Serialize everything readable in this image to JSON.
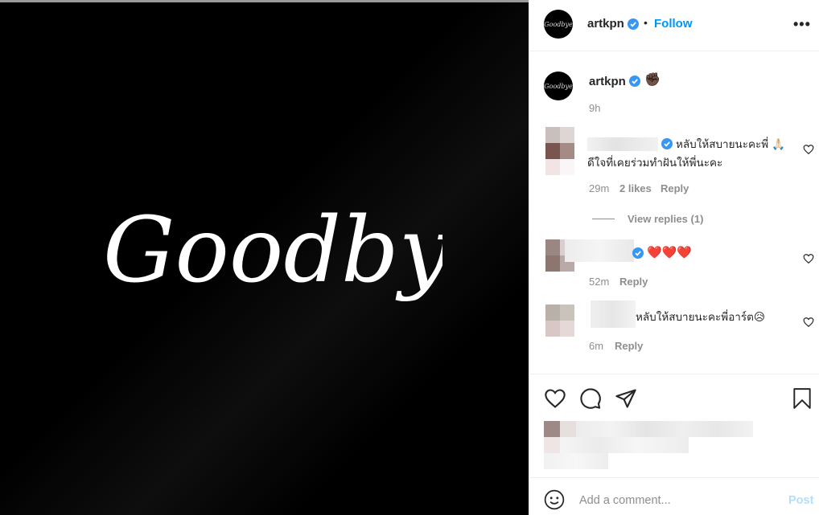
{
  "media": {
    "image_text": "Goodbye"
  },
  "post_header": {
    "username": "artkpn",
    "separator": "•",
    "follow_label": "Follow",
    "more_label": "•••"
  },
  "caption": {
    "username": "artkpn",
    "emoji": "✊🏿",
    "time": "9h"
  },
  "comments": [
    {
      "text": "หลับให้สบายนะคะพี่ 🙏🏻 ดีใจที่เคยร่วมทำฝันให้พี่นะคะ",
      "time": "29m",
      "likes": "2 likes",
      "reply_label": "Reply",
      "view_replies": "View replies (1)"
    },
    {
      "text": "❤️❤️❤️",
      "time": "52m",
      "reply_label": "Reply"
    },
    {
      "text": "หลับให้สบายนะคะพี่อาร์ต😥",
      "time": "6m",
      "reply_label": "Reply"
    }
  ],
  "add_comment": {
    "placeholder": "Add a comment...",
    "post_label": "Post"
  },
  "colors": {
    "accent": "#0095f6",
    "verified": "#3897f0",
    "muted": "#8e8e8e",
    "post_disabled": "#b2dffc",
    "heart_red": "#c4222b"
  }
}
